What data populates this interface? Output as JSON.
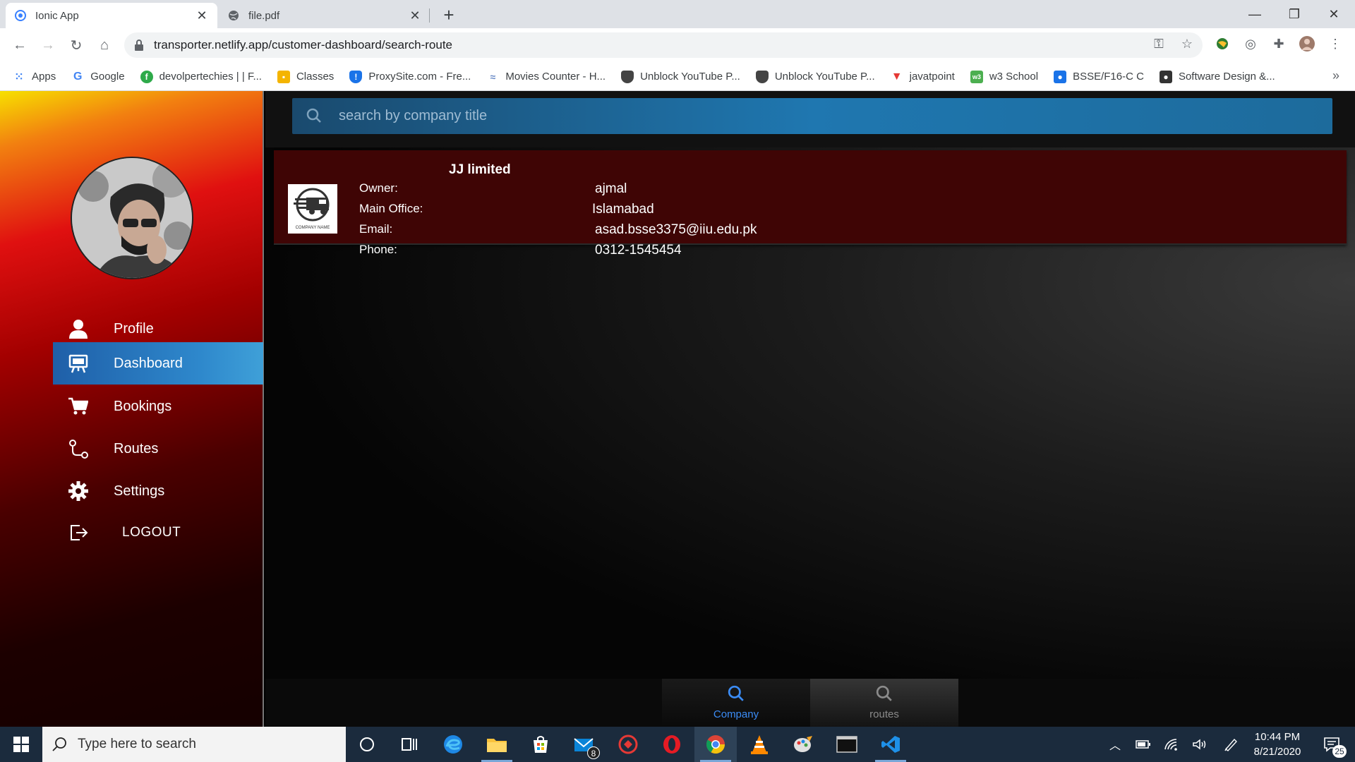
{
  "browser": {
    "tabs": [
      {
        "title": "Ionic App",
        "active": true
      },
      {
        "title": "file.pdf",
        "active": false
      }
    ],
    "url": "transporter.netlify.app/customer-dashboard/search-route",
    "bookmarks": [
      {
        "label": "Apps",
        "icon": "apps-grid-icon",
        "color": "#4285f4"
      },
      {
        "label": "Google",
        "icon": "google-icon",
        "color": "#4285f4"
      },
      {
        "label": "devolpertechies | | F...",
        "icon": "leaf-icon",
        "color": "#2eaa4a"
      },
      {
        "label": "Classes",
        "icon": "classroom-icon",
        "color": "#f4b400"
      },
      {
        "label": "ProxySite.com - Fre...",
        "icon": "shield-icon",
        "color": "#1a73e8"
      },
      {
        "label": "Movies Counter - H...",
        "icon": "movies-icon",
        "color": "#6b8cc7"
      },
      {
        "label": "Unblock YouTube P...",
        "icon": "shield-icon",
        "color": "#444444"
      },
      {
        "label": "Unblock YouTube P...",
        "icon": "shield-icon",
        "color": "#444444"
      },
      {
        "label": "javatpoint",
        "icon": "javatpoint-icon",
        "color": "#e53935"
      },
      {
        "label": "w3 School",
        "icon": "w3-icon",
        "color": "#4caf50"
      },
      {
        "label": "BSSE/F16-C C",
        "icon": "person-icon",
        "color": "#1a73e8"
      },
      {
        "label": "Software Design &...",
        "icon": "classroom-icon",
        "color": "#333333"
      }
    ]
  },
  "sidebar": {
    "items": [
      {
        "label": "Profile",
        "icon": "person-icon",
        "active": false
      },
      {
        "label": "Dashboard",
        "icon": "easel-icon",
        "active": true
      },
      {
        "label": "Bookings",
        "icon": "cart-icon",
        "active": false
      },
      {
        "label": "Routes",
        "icon": "route-icon",
        "active": false
      },
      {
        "label": "Settings",
        "icon": "gear-icon",
        "active": false
      }
    ],
    "logout": "LOGOUT"
  },
  "main": {
    "search": {
      "placeholder": "search by company title"
    },
    "card": {
      "title": "JJ limited",
      "logo_caption": "COMPANY NAME",
      "fields": [
        {
          "label": "Owner:",
          "value": "ajmal"
        },
        {
          "label": "Main Office:",
          "value": "Islamabad"
        },
        {
          "label": "Email:",
          "value": "asad.bsse3375@iiu.edu.pk"
        },
        {
          "label": "Phone:",
          "value": "0312-1545454"
        }
      ]
    },
    "bottom_tabs": [
      {
        "label": "Company",
        "active": true
      },
      {
        "label": "routes",
        "active": false
      }
    ],
    "colors": {
      "accent": "#2e88cc",
      "active_tab": "#3b8cf5",
      "card_bg": "#3f0505"
    }
  },
  "taskbar": {
    "search_placeholder": "Type here to search",
    "mail_badge": "8",
    "time": "10:44 PM",
    "date": "8/21/2020",
    "notifications": "25"
  }
}
